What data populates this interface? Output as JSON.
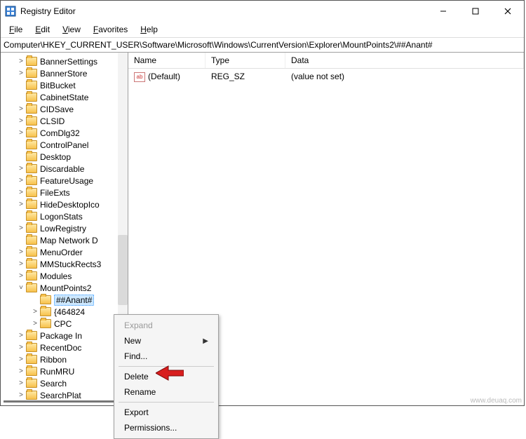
{
  "titlebar": {
    "title": "Registry Editor"
  },
  "menubar": {
    "file": "File",
    "edit": "Edit",
    "view": "View",
    "favorites": "Favorites",
    "help": "Help"
  },
  "address": "Computer\\HKEY_CURRENT_USER\\Software\\Microsoft\\Windows\\CurrentVersion\\Explorer\\MountPoints2\\##Anant#",
  "tree": {
    "items": [
      {
        "l": 1,
        "chev": ">",
        "label": "BannerSettings"
      },
      {
        "l": 1,
        "chev": ">",
        "label": "BannerStore"
      },
      {
        "l": 1,
        "chev": "",
        "label": "BitBucket"
      },
      {
        "l": 1,
        "chev": "",
        "label": "CabinetState"
      },
      {
        "l": 1,
        "chev": ">",
        "label": "CIDSave"
      },
      {
        "l": 1,
        "chev": ">",
        "label": "CLSID"
      },
      {
        "l": 1,
        "chev": ">",
        "label": "ComDlg32"
      },
      {
        "l": 1,
        "chev": "",
        "label": "ControlPanel"
      },
      {
        "l": 1,
        "chev": "",
        "label": "Desktop"
      },
      {
        "l": 1,
        "chev": ">",
        "label": "Discardable"
      },
      {
        "l": 1,
        "chev": ">",
        "label": "FeatureUsage"
      },
      {
        "l": 1,
        "chev": ">",
        "label": "FileExts"
      },
      {
        "l": 1,
        "chev": ">",
        "label": "HideDesktopIco"
      },
      {
        "l": 1,
        "chev": "",
        "label": "LogonStats"
      },
      {
        "l": 1,
        "chev": ">",
        "label": "LowRegistry"
      },
      {
        "l": 1,
        "chev": "",
        "label": "Map Network D"
      },
      {
        "l": 1,
        "chev": ">",
        "label": "MenuOrder"
      },
      {
        "l": 1,
        "chev": ">",
        "label": "MMStuckRects3"
      },
      {
        "l": 1,
        "chev": ">",
        "label": "Modules"
      },
      {
        "l": 1,
        "chev": "v",
        "label": "MountPoints2"
      },
      {
        "l": 2,
        "chev": "",
        "label": "##Anant#",
        "selected": true
      },
      {
        "l": 2,
        "chev": ">",
        "label": "{464824"
      },
      {
        "l": 2,
        "chev": ">",
        "label": "CPC"
      },
      {
        "l": 1,
        "chev": ">",
        "label": "Package In"
      },
      {
        "l": 1,
        "chev": ">",
        "label": "RecentDoc"
      },
      {
        "l": 1,
        "chev": ">",
        "label": "Ribbon"
      },
      {
        "l": 1,
        "chev": ">",
        "label": "RunMRU"
      },
      {
        "l": 1,
        "chev": ">",
        "label": "Search"
      },
      {
        "l": 1,
        "chev": ">",
        "label": "SearchPlat"
      }
    ]
  },
  "list": {
    "columns": {
      "name": "Name",
      "type": "Type",
      "data": "Data"
    },
    "rows": [
      {
        "name": "(Default)",
        "type": "REG_SZ",
        "data": "(value not set)"
      }
    ]
  },
  "contextmenu": {
    "expand": "Expand",
    "new": "New",
    "find": "Find...",
    "delete": "Delete",
    "rename": "Rename",
    "export": "Export",
    "permissions": "Permissions..."
  },
  "watermark": "www.deuaq.com"
}
